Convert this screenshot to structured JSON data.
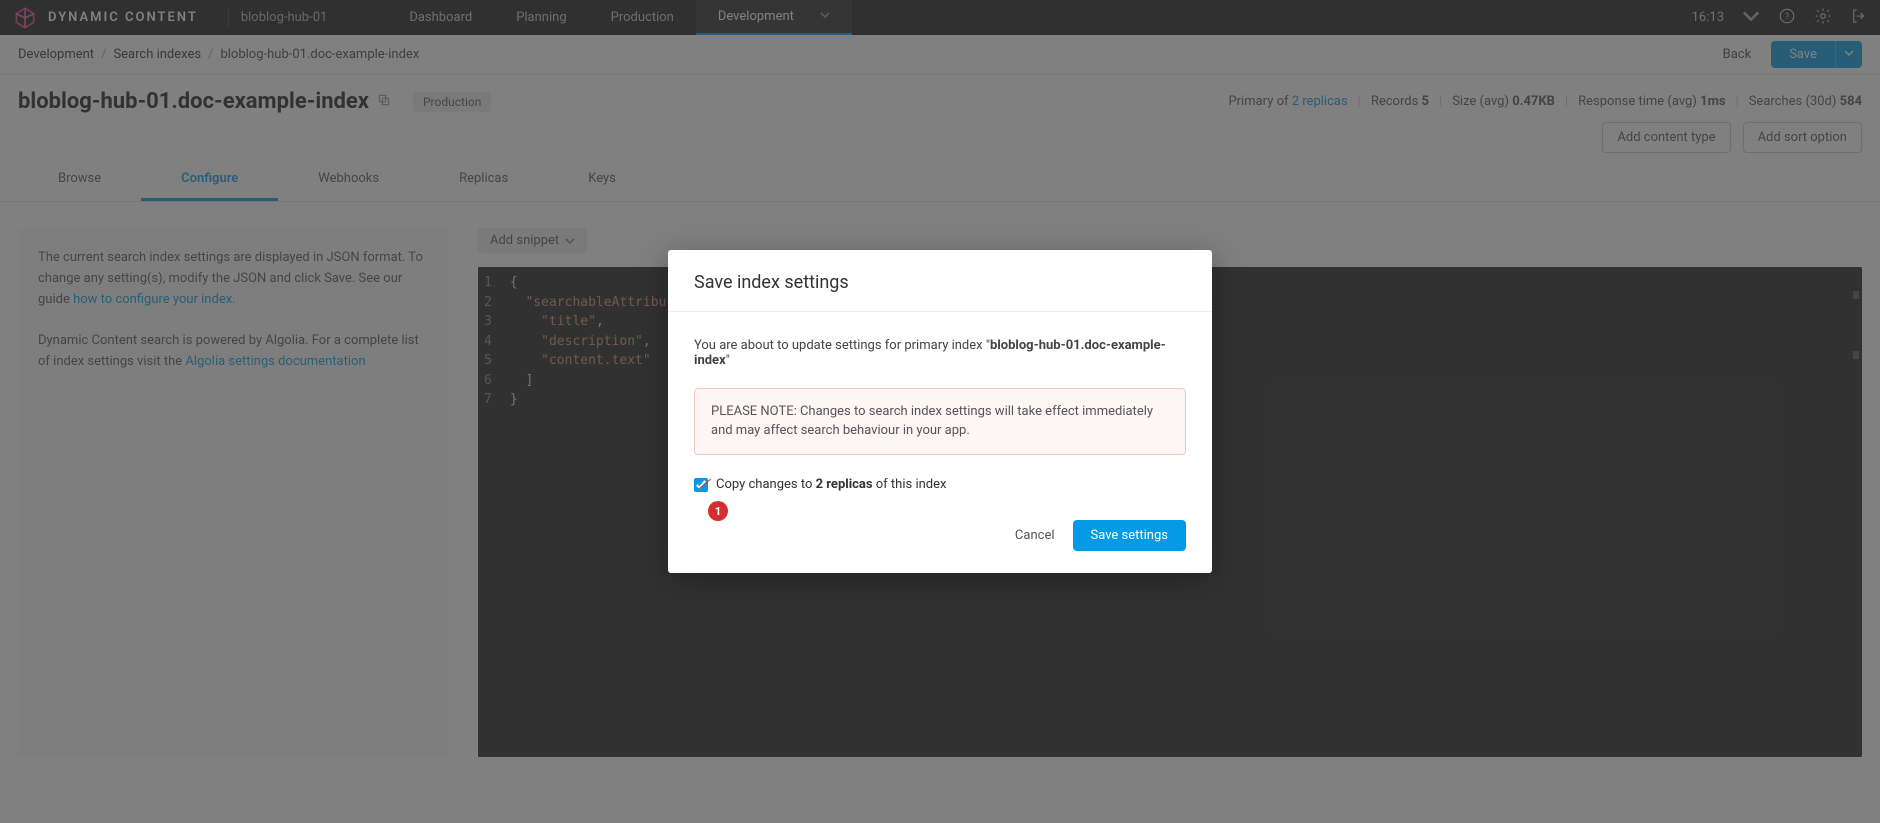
{
  "header": {
    "brand": "DYNAMIC CONTENT",
    "hub": "bloblog-hub-01",
    "tabs": [
      "Dashboard",
      "Planning",
      "Production",
      "Development"
    ],
    "active_tab": 3,
    "time": "16:13"
  },
  "breadcrumb": {
    "items": [
      "Development",
      "Search indexes",
      "bloblog-hub-01.doc-example-index"
    ],
    "back_label": "Back",
    "save_label": "Save"
  },
  "page": {
    "title": "bloblog-hub-01.doc-example-index",
    "env_badge": "Production",
    "stats": {
      "primary_prefix": "Primary of ",
      "primary_link": "2 replicas",
      "records_label": "Records ",
      "records_value": "5",
      "size_label": "Size (avg) ",
      "size_value": "0.47KB",
      "response_label": "Response time (avg) ",
      "response_value": "1ms",
      "searches_label": "Searches (30d) ",
      "searches_value": "584"
    },
    "add_content_type": "Add content type",
    "add_sort_option": "Add sort option"
  },
  "tabs": [
    "Browse",
    "Configure",
    "Webhooks",
    "Replicas",
    "Keys"
  ],
  "active_sub_tab": 1,
  "left_panel": {
    "p1a": "The current search index settings are displayed in JSON format. To change any setting(s), modify the JSON and click Save. See our guide ",
    "p1link": "how to configure your index.",
    "p2a": "Dynamic Content search is powered by Algolia. For a complete list of index settings visit the ",
    "p2link": "Algolia settings documentation"
  },
  "add_snippet": "Add snippet",
  "code": {
    "l1": "{",
    "l2a": "  ",
    "l2b": "\"searchableAttributes\"",
    "l2c": ": [",
    "l3a": "    ",
    "l3b": "\"title\"",
    "l3c": ",",
    "l4a": "    ",
    "l4b": "\"description\"",
    "l4c": ",",
    "l5a": "    ",
    "l5b": "\"content.text\"",
    "l6": "  ]",
    "l7": "}"
  },
  "modal": {
    "title": "Save index settings",
    "confirm_prefix": "You are about to update settings for primary index \"",
    "confirm_index": "bloblog-hub-01.doc-example-index",
    "confirm_suffix": "\"",
    "warn": "PLEASE NOTE: Changes to search index settings will take effect immediately and may affect search behaviour in your app.",
    "copy_prefix": "Copy changes to ",
    "copy_link": "2 replicas",
    "copy_suffix": " of this index",
    "cancel": "Cancel",
    "save": "Save settings",
    "annotation": "1"
  }
}
